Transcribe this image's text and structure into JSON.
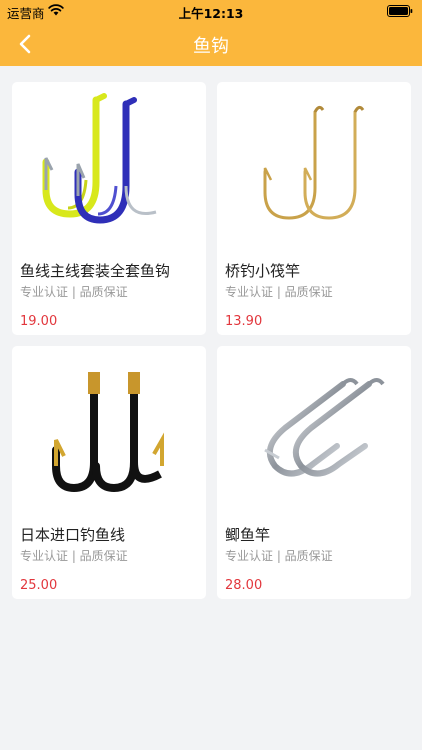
{
  "status_bar": {
    "carrier": "运营商",
    "time": "上午12:13"
  },
  "nav": {
    "title": "鱼钩"
  },
  "products": [
    {
      "title": "鱼线主线套装全套鱼钩",
      "tags": "专业认证 | 品质保证",
      "price": "19.00",
      "image_icon": "yellow-blue-fishhook-icon"
    },
    {
      "title": "桥钓小筏竿",
      "tags": "专业认证 | 品质保证",
      "price": "13.90",
      "image_icon": "gold-double-fishhook-icon"
    },
    {
      "title": "日本进口钓鱼线",
      "tags": "专业认证 | 品质保证",
      "price": "25.00",
      "image_icon": "black-gold-fishhook-icon"
    },
    {
      "title": "鲫鱼竿",
      "tags": "专业认证 | 品质保证",
      "price": "28.00",
      "image_icon": "silver-double-fishhook-icon"
    }
  ],
  "colors": {
    "header_bg": "#fbb73c",
    "page_bg": "#f2f3f5",
    "price": "#e2373d"
  }
}
